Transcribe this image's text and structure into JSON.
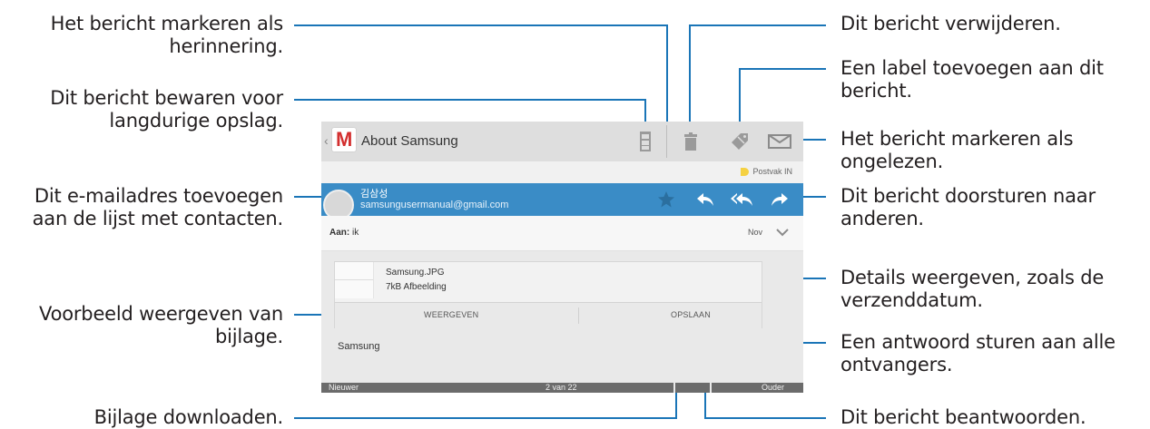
{
  "callouts": {
    "left": [
      "Het bericht markeren als\nherinnering.",
      "Dit bericht bewaren voor\nlangdurige opslag.",
      "Dit e-mailadres toevoegen\naan de lijst met contacten.",
      "Voorbeeld weergeven van\nbijlage.",
      "Bijlage downloaden."
    ],
    "right": [
      "Dit bericht verwijderen.",
      "Een label toevoegen aan dit\nbericht.",
      "Het bericht markeren als\nongelezen.",
      "Dit bericht doorsturen naar\nanderen.",
      "Details weergeven, zoals de\nverzenddatum.",
      "Een antwoord sturen aan alle\nontvangers.",
      "Dit bericht beantwoorden."
    ]
  },
  "app": {
    "title": "About Samsung",
    "logo_letter": "M",
    "actions": [
      "archive-icon",
      "trash-icon",
      "label-tag-icon",
      "mark-unread-icon"
    ]
  },
  "folder": {
    "label": "Postvak IN"
  },
  "sender": {
    "name": "김삼성",
    "email": "samsungusermanual@gmail.com",
    "actions": [
      "star-icon",
      "reply-icon",
      "reply-all-icon",
      "forward-icon"
    ]
  },
  "recipient": {
    "label": "Aan:",
    "value": " ik",
    "date": "Nov"
  },
  "attachment": {
    "filename": "Samsung.JPG",
    "size": "7kB Afbeelding",
    "view_label": "WEERGEVEN",
    "save_label": "OPSLAAN"
  },
  "message": {
    "body": "Samsung"
  },
  "footer": {
    "newer": "Nieuwer",
    "position": "2 van 22",
    "older": "Ouder"
  },
  "colors": {
    "accent": "#3a8cc6",
    "callout_line": "#1a75b7",
    "gmail_red": "#d32f2f"
  }
}
